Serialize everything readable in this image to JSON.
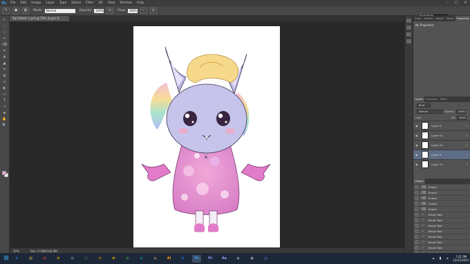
{
  "app": {
    "logo": "Ps",
    "menu": [
      "File",
      "Edit",
      "Image",
      "Layer",
      "Type",
      "Select",
      "Filter",
      "3D",
      "View",
      "Window",
      "Help"
    ],
    "window_controls": [
      "–",
      "□",
      "✕"
    ]
  },
  "options": {
    "mode_label": "Mode:",
    "mode_value": "Normal",
    "opacity_label": "Opacity:",
    "opacity_value": "100%",
    "flow_label": "Flow:",
    "flow_value": "100%",
    "workspace": "Essentials"
  },
  "document": {
    "tab_title": "Bat Sketch 1.psd @ 50% (Layer 9, RGB/8)",
    "zoom": "50%",
    "doc_size": "Doc: 6.18M/142.9M"
  },
  "tools": [
    "↖",
    "⬚",
    "◌",
    "✂",
    "⌫",
    "✒",
    "⚙",
    "▲",
    "✎",
    "◍",
    "⌂",
    "◐",
    "▭",
    "T",
    "↗",
    "◈",
    "✋",
    "🔍"
  ],
  "swatch_colors": {
    "foreground": "#e7a4d6",
    "background": "#ffffff"
  },
  "panels": {
    "top_tabs": [
      "Color",
      "Swatch",
      "Adjust",
      "Styles",
      "Properties"
    ],
    "properties_message": "No Properties",
    "layers_tabs": [
      "Layers",
      "Channels",
      "Paths"
    ],
    "kind_label": "Kind",
    "blend_mode": "Normal",
    "opacity_label": "Opacity:",
    "opacity_value": "100%",
    "lock_label": "Lock:",
    "fill_label": "Fill:",
    "fill_value": "100%",
    "layers": [
      {
        "name": "Layer 5"
      },
      {
        "name": "Layer 14"
      },
      {
        "name": "Layer 10"
      },
      {
        "name": "Layer 9",
        "selected": true
      },
      {
        "name": "Layer 12"
      }
    ],
    "history_title": "History",
    "history": [
      "Eraser",
      "Eraser",
      "Eraser",
      "Eraser",
      "Eraser",
      "Brush Tool",
      "Brush Tool",
      "Brush Tool",
      "Brush Tool",
      "Brush Tool",
      "Brush Tool",
      "Brush Tool",
      "Brush Tool",
      "Brush Tool"
    ]
  },
  "taskbar": {
    "apps": [
      {
        "g": "e",
        "color": "#2b6bd6"
      },
      {
        "g": "▤",
        "color": "#f2c94c"
      },
      {
        "g": "◍",
        "color": "#e53935"
      },
      {
        "g": "⚙",
        "color": "#fbbc05"
      },
      {
        "g": "▦",
        "color": "#607d8b"
      },
      {
        "g": "⬡",
        "color": "#4caf50"
      },
      {
        "g": "◔",
        "color": "#fb8c00"
      },
      {
        "g": "◓",
        "color": "#ffb300"
      },
      {
        "g": "◍",
        "color": "#43a047"
      },
      {
        "g": "◍",
        "color": "#0097a7"
      },
      {
        "g": "▣",
        "color": "#8d6e63"
      },
      {
        "g": "Ai",
        "color": "#ff9a00"
      },
      {
        "g": "▦",
        "color": "#1565c0"
      },
      {
        "g": "Ps",
        "color": "#31a8ff",
        "active": true
      },
      {
        "g": "Pr",
        "color": "#9999ff"
      },
      {
        "g": "Ae",
        "color": "#9999ff"
      },
      {
        "g": "◉",
        "color": "#90a4ae"
      },
      {
        "g": "◍",
        "color": "#e0e0e0"
      },
      {
        "g": "▤",
        "color": "#5c6bc0"
      }
    ],
    "time": "7:21 PM",
    "date": "12/11/2015"
  }
}
